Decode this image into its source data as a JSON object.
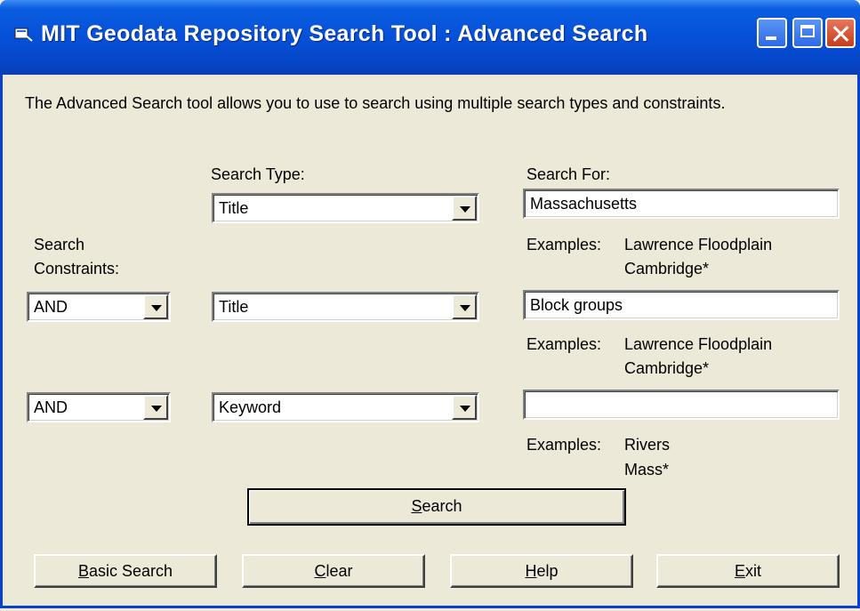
{
  "window": {
    "title": "MIT Geodata Repository Search Tool  : Advanced Search",
    "icon": "app-icon"
  },
  "intro": "The Advanced Search tool allows you to use to search using multiple search types and constraints.",
  "labels": {
    "search_type": "Search Type:",
    "search_for": "Search For:",
    "constraints_line1": "Search",
    "constraints_line2": "Constraints:"
  },
  "rows": [
    {
      "type": "Title",
      "query": "Massachusetts",
      "examples_label": "Examples:",
      "example1": "Lawrence Floodplain",
      "example2": "Cambridge*"
    },
    {
      "constraint": "AND",
      "type": "Title",
      "query": "Block groups",
      "examples_label": "Examples:",
      "example1": "Lawrence Floodplain",
      "example2": "Cambridge*"
    },
    {
      "constraint": "AND",
      "type": "Keyword",
      "query": "",
      "examples_label": "Examples:",
      "example1": "Rivers",
      "example2": "Mass*"
    }
  ],
  "buttons": {
    "search": {
      "accel": "S",
      "rest": "earch"
    },
    "basic": {
      "accel": "B",
      "rest": "asic Search"
    },
    "clear": {
      "accel": "C",
      "rest": "lear"
    },
    "help": {
      "accel": "H",
      "rest": "elp"
    },
    "exit": {
      "accel": "E",
      "rest": "xit"
    }
  }
}
